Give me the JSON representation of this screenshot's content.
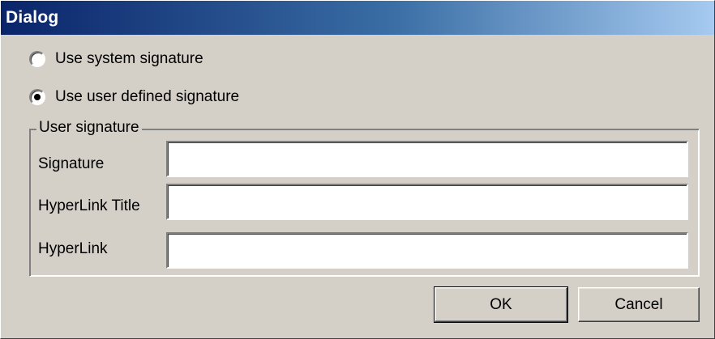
{
  "window": {
    "title": "Dialog"
  },
  "signature_options": [
    {
      "label": "Use system signature",
      "selected": false
    },
    {
      "label": "Use user defined signature",
      "selected": true
    }
  ],
  "user_signature_group": {
    "legend": "User signature",
    "fields": [
      {
        "label": "Signature",
        "value": ""
      },
      {
        "label": "HyperLink Title",
        "value": ""
      },
      {
        "label": "HyperLink",
        "value": ""
      }
    ]
  },
  "buttons": {
    "ok_label": "OK",
    "cancel_label": "Cancel"
  },
  "colors": {
    "title_gradient_start": "#0a246a",
    "title_gradient_end": "#a6caf0",
    "dialog_background": "#d4d0c8"
  }
}
